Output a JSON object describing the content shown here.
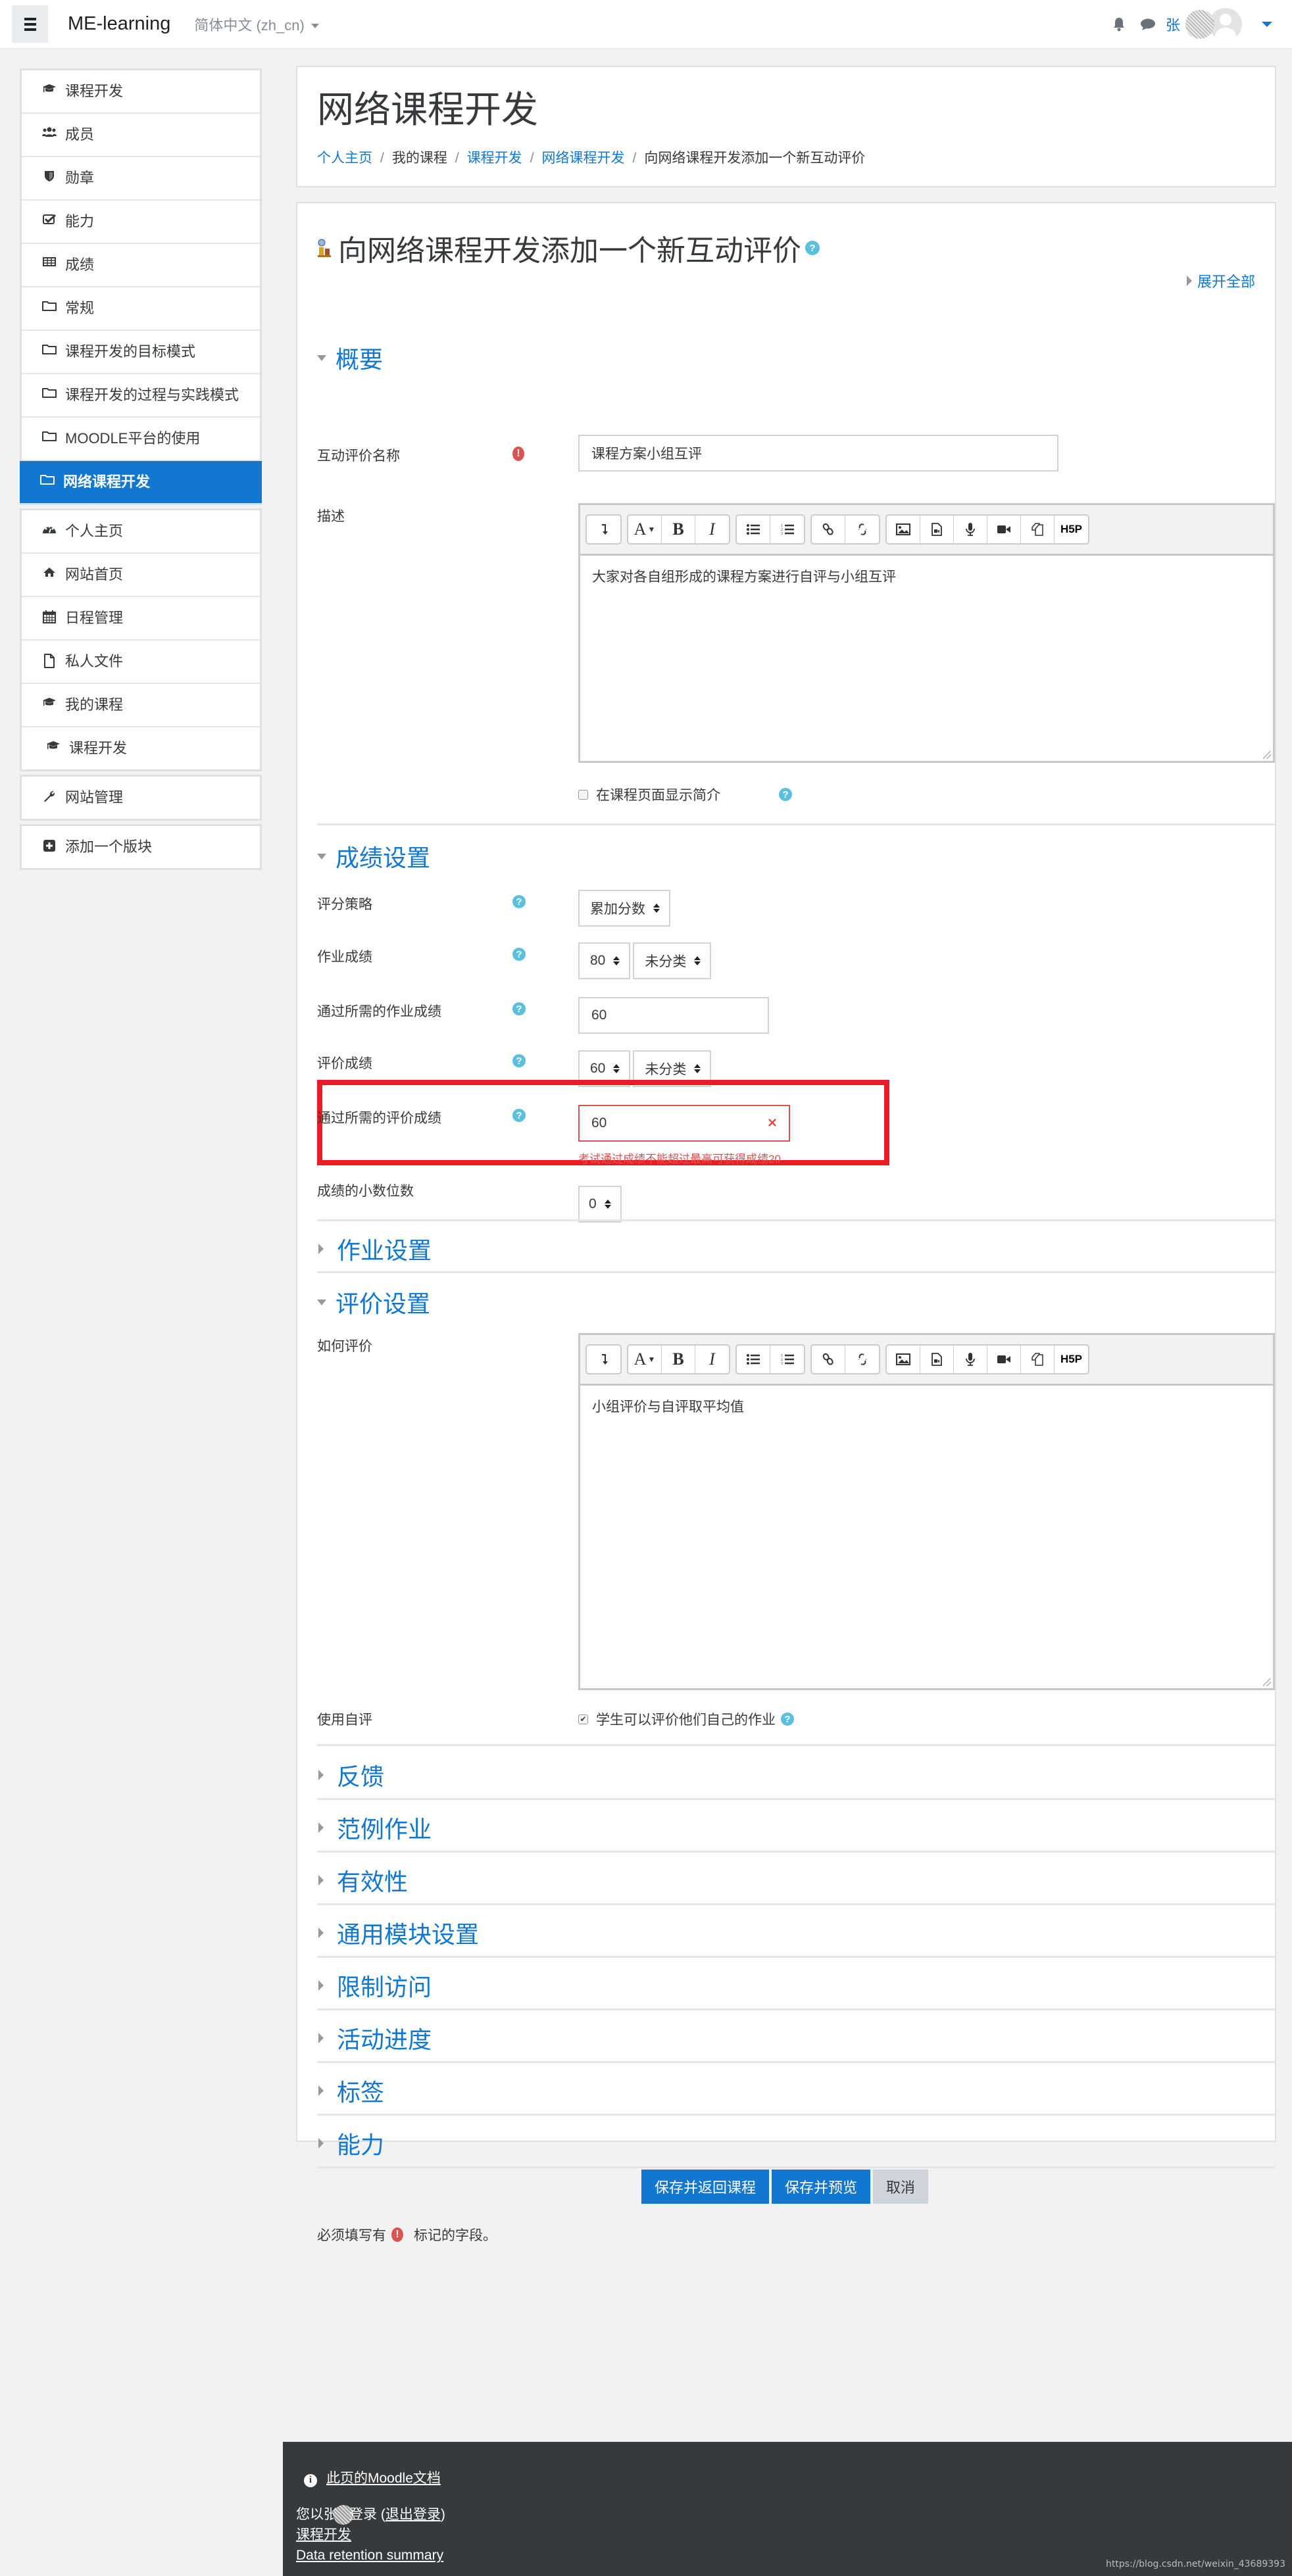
{
  "navbar": {
    "brand": "ME-learning",
    "language": "简体中文 (zh_cn)",
    "user_initial": "张"
  },
  "sidebar": {
    "groups": [
      [
        {
          "label": "课程开发",
          "icon": "graduation-cap-icon"
        },
        {
          "label": "成员",
          "icon": "users-icon"
        },
        {
          "label": "勋章",
          "icon": "shield-icon"
        },
        {
          "label": "能力",
          "icon": "check-square-icon"
        },
        {
          "label": "成绩",
          "icon": "table-icon"
        },
        {
          "label": "常规",
          "icon": "folder-icon"
        },
        {
          "label": "课程开发的目标模式",
          "icon": "folder-icon"
        },
        {
          "label": "课程开发的过程与实践模式",
          "icon": "folder-icon"
        },
        {
          "label": "MOODLE平台的使用",
          "icon": "folder-icon"
        },
        {
          "label": "网络课程开发",
          "icon": "folder-icon",
          "active": true
        }
      ],
      [
        {
          "label": "个人主页",
          "icon": "dashboard-icon"
        },
        {
          "label": "网站首页",
          "icon": "home-icon"
        },
        {
          "label": "日程管理",
          "icon": "calendar-icon"
        },
        {
          "label": "私人文件",
          "icon": "file-icon"
        },
        {
          "label": "我的课程",
          "icon": "graduation-cap-icon"
        },
        {
          "label": "课程开发",
          "icon": "graduation-cap-icon"
        }
      ],
      [
        {
          "label": "网站管理",
          "icon": "wrench-icon"
        }
      ],
      [
        {
          "label": "添加一个版块",
          "icon": "plus-square-icon"
        }
      ]
    ]
  },
  "header": {
    "title": "网络课程开发",
    "breadcrumb": [
      {
        "label": "个人主页",
        "link": true
      },
      {
        "label": "我的课程",
        "link": false
      },
      {
        "label": "课程开发",
        "link": true
      },
      {
        "label": "网络课程开发",
        "link": true
      },
      {
        "label": "向网络课程开发添加一个新互动评价",
        "link": false
      }
    ]
  },
  "form": {
    "title": "向网络课程开发添加一个新互动评价",
    "expand_all": "展开全部",
    "general": {
      "heading": "概要",
      "name_label": "互动评价名称",
      "name_value": "课程方案小组互评",
      "desc_label": "描述",
      "desc_value": "大家对各自组形成的课程方案进行自评与小组互评",
      "show_desc_label": "在课程页面显示简介",
      "show_desc_checked": false
    },
    "grading": {
      "heading": "成绩设置",
      "strategy_label": "评分策略",
      "strategy_value": "累加分数",
      "submission_grade_label": "作业成绩",
      "submission_grade_value": "80",
      "submission_category_value": "未分类",
      "submission_pass_label": "通过所需的作业成绩",
      "submission_pass_value": "60",
      "assessment_grade_label": "评价成绩",
      "assessment_grade_value": "60",
      "assessment_category_value": "未分类",
      "assessment_pass_label": "通过所需的评价成绩",
      "assessment_pass_value": "60",
      "assessment_pass_error": "考试通过成绩不能超过最高可获得成绩20",
      "decimals_label": "成绩的小数位数",
      "decimals_value": "0"
    },
    "submission_settings": {
      "heading": "作业设置"
    },
    "assessment_settings": {
      "heading": "评价设置",
      "instructions_label": "如何评价",
      "instructions_value": "小组评价与自评取平均值",
      "self_assess_label": "使用自评",
      "self_assess_option": "学生可以评价他们自己的作业",
      "self_assess_checked": true
    },
    "collapsed_sections": [
      "反馈",
      "范例作业",
      "有效性",
      "通用模块设置",
      "限制访问",
      "活动进度",
      "标签",
      "能力"
    ],
    "buttons": {
      "save_return": "保存并返回课程",
      "save_display": "保存并预览",
      "cancel": "取消"
    },
    "required_note_before": "必须填写有",
    "required_note_after": "标记的字段。"
  },
  "editor_toolbar": {
    "groups": [
      [
        "collapse-icon"
      ],
      [
        "paragraph-style-icon",
        "bold-icon",
        "italic-icon"
      ],
      [
        "unordered-list-icon",
        "ordered-list-icon"
      ],
      [
        "link-icon",
        "unlink-icon"
      ],
      [
        "image-icon",
        "media-icon",
        "record-audio-icon",
        "record-video-icon",
        "manage-files-icon",
        "h5p-icon"
      ]
    ]
  },
  "footer": {
    "docs_link": "此页的Moodle文档",
    "logged_in_prefix": "您以张",
    "logged_in_suffix": "登录 (",
    "logout": "退出登录",
    "logged_in_close": ")",
    "course_link": "课程开发",
    "data_retention": "Data retention summary",
    "watermark": "https://blog.csdn.net/weixin_43689393"
  },
  "colors": {
    "primary": "#1177d1",
    "error": "#d9534f",
    "highlight_box": "#ed1c24",
    "help": "#5bc0de",
    "footer_bg": "#373a3c"
  }
}
